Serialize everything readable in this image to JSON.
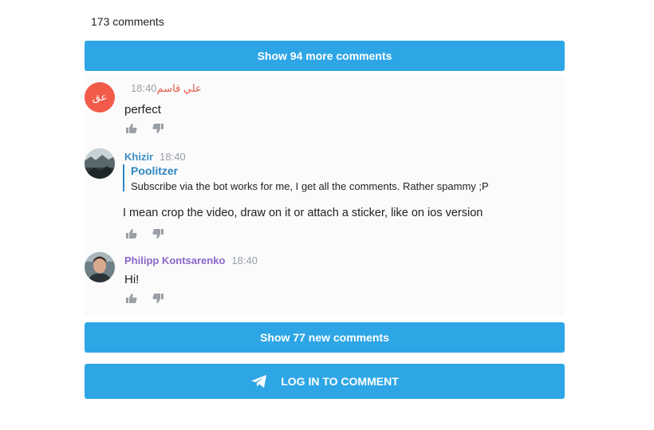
{
  "comments_count": "173 comments",
  "show_more_label": "Show 94 more comments",
  "show_new_label": "Show 77 new comments",
  "login_label": "LOG IN TO COMMENT",
  "comments": [
    {
      "author": "علي قاسم",
      "avatar_letters": "عق",
      "author_color": "#e25b4b",
      "time": "18:40",
      "text": "perfect"
    },
    {
      "author": "Khizir",
      "author_color": "#3d8fc4",
      "time": "18:40",
      "reply": {
        "author": "Poolitzer",
        "text": "Subscribe via the bot works for me, I get all the comments. Rather spammy ;P"
      },
      "text": "I mean crop the video, draw on it or attach a sticker, like on ios version"
    },
    {
      "author": "Philipp Kontsarenko",
      "author_color": "#8a67c9",
      "time": "18:40",
      "text": "Hi!"
    }
  ],
  "colors": {
    "button": "#2ea6e6",
    "reply_accent": "#2e86c1"
  },
  "icons": [
    "thumbs-up-icon",
    "thumbs-down-icon",
    "telegram-plane-icon"
  ]
}
